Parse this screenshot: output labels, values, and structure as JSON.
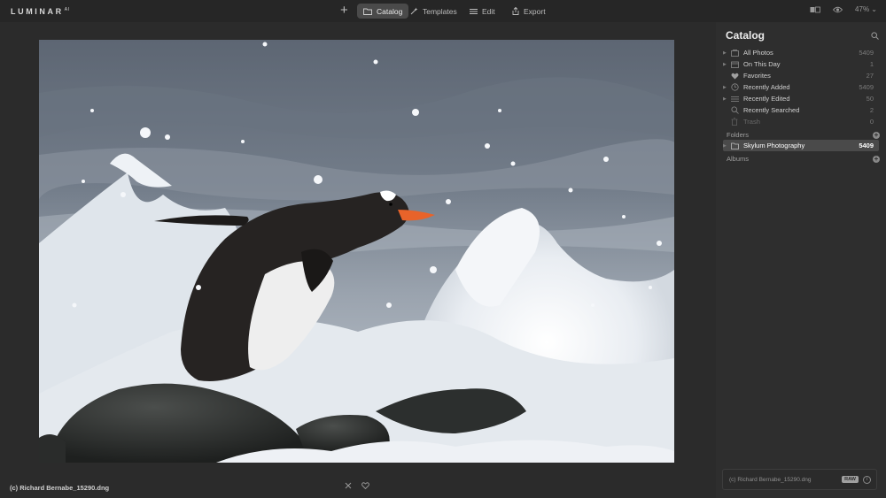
{
  "app": {
    "logo": "LUMINAR",
    "logo_suffix": "AI"
  },
  "toolbar": {
    "tabs": [
      {
        "label": "Catalog",
        "icon": "folder-icon",
        "active": true
      },
      {
        "label": "Templates",
        "icon": "wand-icon",
        "active": false
      },
      {
        "label": "Edit",
        "icon": "sliders-icon",
        "active": false
      },
      {
        "label": "Export",
        "icon": "share-icon",
        "active": false
      }
    ],
    "zoom": "47%"
  },
  "photo": {
    "caption": "(c) Richard Bernabe_15290.dng"
  },
  "sidebar": {
    "title": "Catalog",
    "items": [
      {
        "label": "All Photos",
        "count": "5409",
        "icon": "photos-icon",
        "expandable": true
      },
      {
        "label": "On This Day",
        "count": "1",
        "icon": "calendar-icon",
        "expandable": true
      },
      {
        "label": "Favorites",
        "count": "27",
        "icon": "heart-icon",
        "expandable": false
      },
      {
        "label": "Recently Added",
        "count": "5409",
        "icon": "clock-icon",
        "expandable": true
      },
      {
        "label": "Recently Edited",
        "count": "50",
        "icon": "sliders-icon",
        "expandable": true
      },
      {
        "label": "Recently Searched",
        "count": "2",
        "icon": "search-icon",
        "expandable": false
      },
      {
        "label": "Trash",
        "count": "0",
        "icon": "trash-icon",
        "expandable": false
      }
    ],
    "folders_label": "Folders",
    "folder": {
      "label": "Skylum Photography",
      "count": "5409"
    },
    "albums_label": "Albums",
    "info": {
      "filename": "(c) Richard Bernabe_15290.dng",
      "badge": "RAW"
    }
  },
  "colors": {
    "accent": "#4a4a4a",
    "background": "#2b2b2b",
    "panel": "#2e2e2e"
  }
}
